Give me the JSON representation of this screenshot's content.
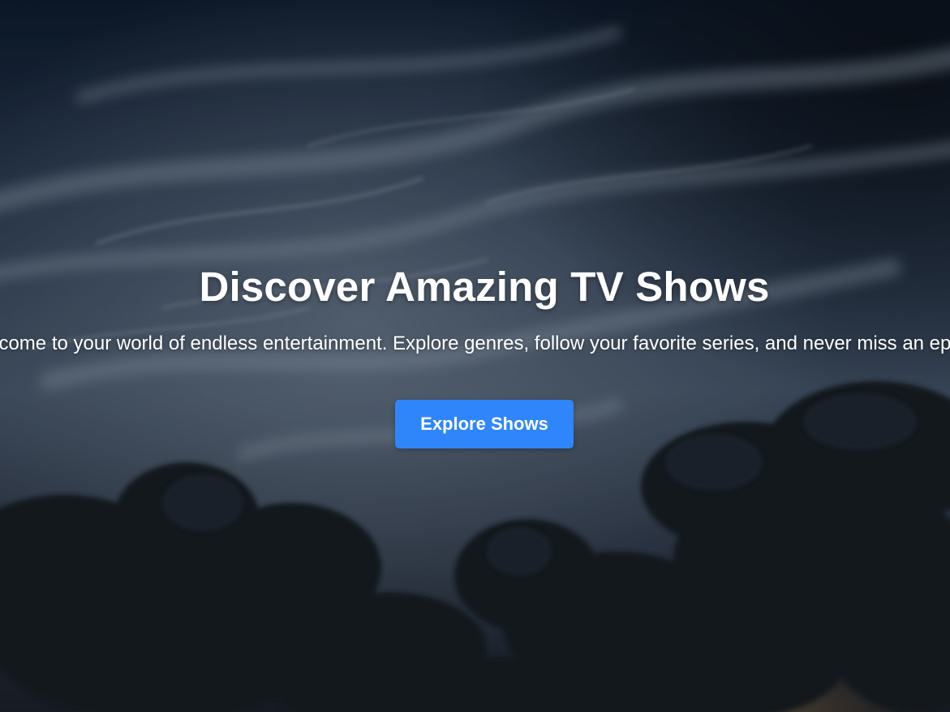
{
  "hero": {
    "title": "Discover Amazing TV Shows",
    "subtitle": "Welcome to your world of endless entertainment. Explore genres, follow your favorite series, and never miss an episode.",
    "cta_label": "Explore Shows"
  },
  "colors": {
    "cta_background": "#2f86fa",
    "text": "#ffffff",
    "sky_top": "#0d1a2c",
    "sky_mid": "#3a4a5e",
    "clouds_dark": "#151a22",
    "sunset_glow": "#c99a48"
  }
}
